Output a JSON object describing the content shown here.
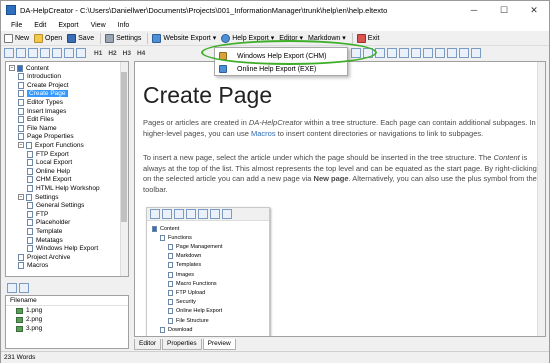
{
  "window": {
    "title": "DA-HelpCreator - C:\\Users\\Daniellwer\\Documents\\Projects\\001_InformationManager\\trunk\\help\\en\\help.eltexto",
    "minimize": "─",
    "maximize": "☐",
    "close": "✕"
  },
  "menu": [
    "File",
    "Edit",
    "Export",
    "View",
    "Info"
  ],
  "toolbar": {
    "new": "New",
    "open": "Open",
    "save": "Save",
    "settings": "Settings",
    "website_export": "Website Export",
    "help_export": "Help Export",
    "editor": "Editor",
    "markdown": "Markdown",
    "exit": "Exit",
    "headings": [
      "H1",
      "H2",
      "H3",
      "H4"
    ]
  },
  "dropdown": {
    "items": [
      "Windows Help Export (CHM)",
      "Online Help Export (EXE)"
    ]
  },
  "tree": {
    "items": [
      {
        "label": "Content",
        "level": 0,
        "expand": "−"
      },
      {
        "label": "Introduction",
        "level": 1
      },
      {
        "label": "Create Project",
        "level": 1
      },
      {
        "label": "Create Page",
        "level": 1,
        "selected": true
      },
      {
        "label": "Editor Types",
        "level": 1
      },
      {
        "label": "Insert Images",
        "level": 1
      },
      {
        "label": "Edit Files",
        "level": 1
      },
      {
        "label": "File Name",
        "level": 1
      },
      {
        "label": "Page Properties",
        "level": 1
      },
      {
        "label": "Export Functions",
        "level": 1,
        "expand": "−"
      },
      {
        "label": "FTP Export",
        "level": 2
      },
      {
        "label": "Local Export",
        "level": 2
      },
      {
        "label": "Online Help",
        "level": 2
      },
      {
        "label": "CHM Export",
        "level": 2
      },
      {
        "label": "HTML Help Workshop",
        "level": 2
      },
      {
        "label": "Settings",
        "level": 1,
        "expand": "−"
      },
      {
        "label": "General Settings",
        "level": 2
      },
      {
        "label": "FTP",
        "level": 2
      },
      {
        "label": "Placeholder",
        "level": 2
      },
      {
        "label": "Template",
        "level": 2
      },
      {
        "label": "Metatags",
        "level": 2
      },
      {
        "label": "Windows Help Export",
        "level": 2
      },
      {
        "label": "Project Archive",
        "level": 1
      },
      {
        "label": "Macros",
        "level": 1
      }
    ]
  },
  "files": {
    "header": "Filename",
    "items": [
      "1.png",
      "2.png",
      "3.png"
    ]
  },
  "status": {
    "words": "231 Words"
  },
  "content": {
    "heading": "Create Page",
    "p1_a": "Pages or articles are created in ",
    "p1_app": "DA-HelpCreator",
    "p1_b": " within a tree structure. Each page can contain additional subpages. In higher-level pages, you can use ",
    "p1_link": "Macros",
    "p1_c": " to insert content directories or navigations to link to subpages.",
    "p2_a": "To insert a new page, select the article under which the page should be inserted in the tree structure. The ",
    "p2_content": "Content",
    "p2_b": " is always at the top of the list. This almost represents the top level and can be equated as the start page. By right-clicking on the selected article you can add a new page via ",
    "p2_bold": "New page",
    "p2_c": ". Alternatively, you can also use the plus symbol from the toolbar."
  },
  "embedded": {
    "items": [
      {
        "label": "Content",
        "level": 0
      },
      {
        "label": "Functions",
        "level": 1
      },
      {
        "label": "Page Management",
        "level": 2
      },
      {
        "label": "Markdown",
        "level": 2
      },
      {
        "label": "Templates",
        "level": 2
      },
      {
        "label": "Images",
        "level": 2
      },
      {
        "label": "Macro Functions",
        "level": 2
      },
      {
        "label": "FTP Upload",
        "level": 2
      },
      {
        "label": "Security",
        "level": 2
      },
      {
        "label": "Online Help Export",
        "level": 2
      },
      {
        "label": "File Structure",
        "level": 2
      },
      {
        "label": "Download",
        "level": 1
      }
    ]
  },
  "tabs": [
    "Editor",
    "Properties",
    "Preview"
  ],
  "colors": {
    "accent": "#3399ff",
    "link": "#2a6ab0",
    "highlight": "#3fae2a"
  }
}
